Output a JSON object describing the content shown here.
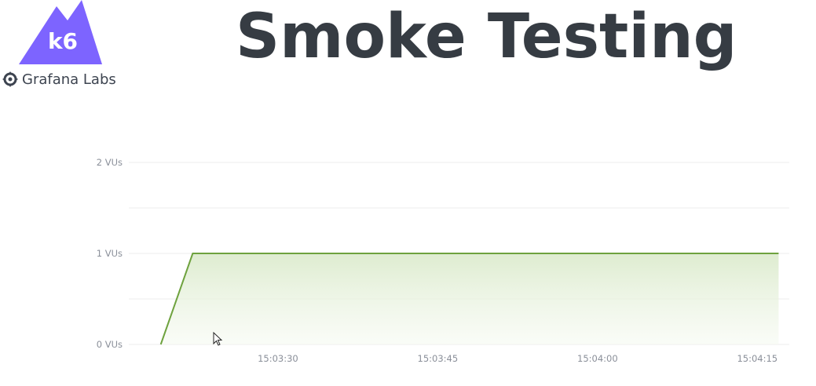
{
  "title": "Smoke Testing",
  "brand": {
    "k6_label": "k6",
    "grafana_label": "Grafana Labs",
    "k6_color": "#7d64ff",
    "grafana_icon": "grafana-gear-icon"
  },
  "chart_data": {
    "type": "area",
    "title": "",
    "xlabel": "",
    "ylabel": "",
    "x_tick_labels": [
      "15:03:30",
      "15:03:45",
      "15:04:00",
      "15:04:15"
    ],
    "y_tick_labels": [
      "0 VUs",
      "1 VUs",
      "2 VUs"
    ],
    "ylim": [
      0,
      2
    ],
    "xlim": [
      "15:03:16",
      "15:04:18"
    ],
    "series": [
      {
        "x": [
          "15:03:19",
          "15:03:22",
          "15:04:17"
        ],
        "y": [
          0,
          1,
          1
        ],
        "color": "#6ea23e",
        "fill_color": "#e4f0d8"
      }
    ],
    "grid": true,
    "legend": "none"
  }
}
